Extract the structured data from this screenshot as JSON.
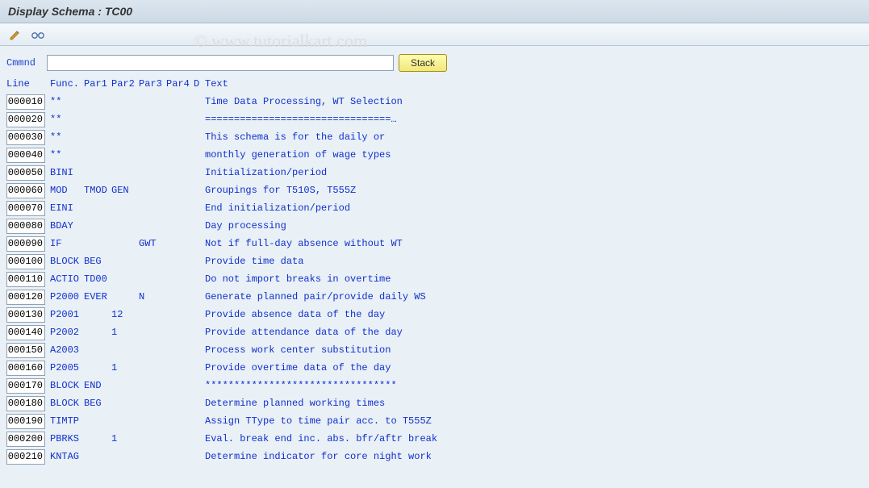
{
  "title": "Display Schema : TC00",
  "watermark": "© www.tutorialkart.com",
  "cmd": {
    "label": "Cmmnd",
    "value": "",
    "stack_label": "Stack"
  },
  "headers": {
    "line": "Line",
    "func": "Func.",
    "par1": "Par1",
    "par2": "Par2",
    "par3": "Par3",
    "par4": "Par4",
    "d": "D",
    "text": "Text"
  },
  "rows": [
    {
      "line": "000010",
      "func": "**",
      "par1": "",
      "par2": "",
      "par3": "",
      "par4": "",
      "d": "",
      "text": "Time Data Processing, WT Selection"
    },
    {
      "line": "000020",
      "func": "**",
      "par1": "",
      "par2": "",
      "par3": "",
      "par4": "",
      "d": "",
      "text": "================================…"
    },
    {
      "line": "000030",
      "func": "**",
      "par1": "",
      "par2": "",
      "par3": "",
      "par4": "",
      "d": "",
      "text": "This schema is for the daily or"
    },
    {
      "line": "000040",
      "func": "**",
      "par1": "",
      "par2": "",
      "par3": "",
      "par4": "",
      "d": "",
      "text": "monthly generation of wage types"
    },
    {
      "line": "000050",
      "func": "BINI",
      "par1": "",
      "par2": "",
      "par3": "",
      "par4": "",
      "d": "",
      "text": "Initialization/period"
    },
    {
      "line": "000060",
      "func": "MOD",
      "par1": "TMOD",
      "par2": "GEN",
      "par3": "",
      "par4": "",
      "d": "",
      "text": "Groupings for T510S, T555Z"
    },
    {
      "line": "000070",
      "func": "EINI",
      "par1": "",
      "par2": "",
      "par3": "",
      "par4": "",
      "d": "",
      "text": "End initialization/period"
    },
    {
      "line": "000080",
      "func": "BDAY",
      "par1": "",
      "par2": "",
      "par3": "",
      "par4": "",
      "d": "",
      "text": "Day processing"
    },
    {
      "line": "000090",
      "func": "IF",
      "par1": "",
      "par2": "",
      "par3": "GWT",
      "par4": "",
      "d": "",
      "text": "Not if full-day absence without WT"
    },
    {
      "line": "000100",
      "func": "BLOCK",
      "par1": "BEG",
      "par2": "",
      "par3": "",
      "par4": "",
      "d": "",
      "text": "Provide time data"
    },
    {
      "line": "000110",
      "func": "ACTIO",
      "par1": "TD00",
      "par2": "",
      "par3": "",
      "par4": "",
      "d": "",
      "text": "Do not import breaks in overtime"
    },
    {
      "line": "000120",
      "func": "P2000",
      "par1": "EVER",
      "par2": "",
      "par3": "N",
      "par4": "",
      "d": "",
      "text": "Generate planned pair/provide daily WS"
    },
    {
      "line": "000130",
      "func": "P2001",
      "par1": "",
      "par2": "12",
      "par3": "",
      "par4": "",
      "d": "",
      "text": "Provide absence data of the day"
    },
    {
      "line": "000140",
      "func": "P2002",
      "par1": "",
      "par2": "1",
      "par3": "",
      "par4": "",
      "d": "",
      "text": "Provide attendance data of the day"
    },
    {
      "line": "000150",
      "func": "A2003",
      "par1": "",
      "par2": "",
      "par3": "",
      "par4": "",
      "d": "",
      "text": "Process work center substitution"
    },
    {
      "line": "000160",
      "func": "P2005",
      "par1": "",
      "par2": "1",
      "par3": "",
      "par4": "",
      "d": "",
      "text": "Provide overtime data of the day"
    },
    {
      "line": "000170",
      "func": "BLOCK",
      "par1": "END",
      "par2": "",
      "par3": "",
      "par4": "",
      "d": "",
      "text": "*********************************"
    },
    {
      "line": "000180",
      "func": "BLOCK",
      "par1": "BEG",
      "par2": "",
      "par3": "",
      "par4": "",
      "d": "",
      "text": "Determine planned working times"
    },
    {
      "line": "000190",
      "func": "TIMTP",
      "par1": "",
      "par2": "",
      "par3": "",
      "par4": "",
      "d": "",
      "text": "Assign TType to time pair acc. to T555Z"
    },
    {
      "line": "000200",
      "func": "PBRKS",
      "par1": "",
      "par2": "1",
      "par3": "",
      "par4": "",
      "d": "",
      "text": "Eval. break end inc. abs. bfr/aftr break"
    },
    {
      "line": "000210",
      "func": "KNTAG",
      "par1": "",
      "par2": "",
      "par3": "",
      "par4": "",
      "d": "",
      "text": "Determine indicator for core night work"
    }
  ]
}
